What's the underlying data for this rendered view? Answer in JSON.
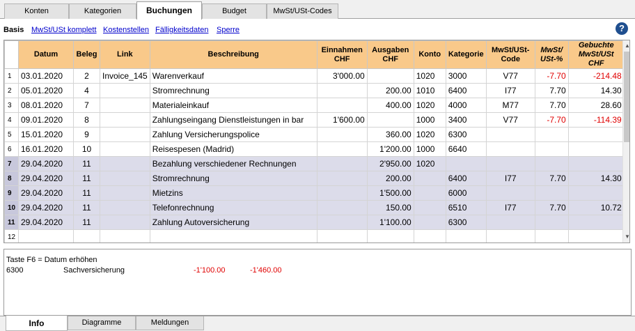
{
  "tabs": [
    "Konten",
    "Kategorien",
    "Buchungen",
    "Budget",
    "MwSt/USt-Codes"
  ],
  "active_tab": "Buchungen",
  "subbar": {
    "view": "Basis",
    "links": [
      "MwSt/USt komplett",
      "Kostenstellen",
      "Fälligkeitsdaten",
      "Sperre"
    ],
    "help": "?"
  },
  "columns": [
    {
      "l1": "Datum",
      "l2": ""
    },
    {
      "l1": "Beleg",
      "l2": ""
    },
    {
      "l1": "Link",
      "l2": ""
    },
    {
      "l1": "Beschreibung",
      "l2": ""
    },
    {
      "l1": "Einnahmen",
      "l2": "CHF"
    },
    {
      "l1": "Ausgaben",
      "l2": "CHF"
    },
    {
      "l1": "Konto",
      "l2": ""
    },
    {
      "l1": "Kategorie",
      "l2": ""
    },
    {
      "l1": "MwSt/USt-",
      "l2": "Code"
    },
    {
      "l1": "MwSt/",
      "l2": "USt-%"
    },
    {
      "l1": "Gebuchte",
      "l2": "MwSt/USt CHF"
    }
  ],
  "rows": [
    {
      "n": "1",
      "datum": "03.01.2020",
      "beleg": "2",
      "link": "Invoice_145",
      "beschreibung": "Warenverkauf",
      "einnahmen": "3'000.00",
      "ausgaben": "",
      "konto": "1020",
      "kategorie": "3000",
      "code": "V77",
      "pct": "-7.70",
      "gebucht": "-214.48"
    },
    {
      "n": "2",
      "datum": "05.01.2020",
      "beleg": "4",
      "link": "",
      "beschreibung": "Stromrechnung",
      "einnahmen": "",
      "ausgaben": "200.00",
      "konto": "1010",
      "kategorie": "6400",
      "code": "I77",
      "pct": "7.70",
      "gebucht": "14.30"
    },
    {
      "n": "3",
      "datum": "08.01.2020",
      "beleg": "7",
      "link": "",
      "beschreibung": "Materialeinkauf",
      "einnahmen": "",
      "ausgaben": "400.00",
      "konto": "1020",
      "kategorie": "4000",
      "code": "M77",
      "pct": "7.70",
      "gebucht": "28.60"
    },
    {
      "n": "4",
      "datum": "09.01.2020",
      "beleg": "8",
      "link": "",
      "beschreibung": "Zahlungseingang Dienstleistungen in bar",
      "einnahmen": "1'600.00",
      "ausgaben": "",
      "konto": "1000",
      "kategorie": "3400",
      "code": "V77",
      "pct": "-7.70",
      "gebucht": "-114.39"
    },
    {
      "n": "5",
      "datum": "15.01.2020",
      "beleg": "9",
      "link": "",
      "beschreibung": "Zahlung Versicherungspolice",
      "einnahmen": "",
      "ausgaben": "360.00",
      "konto": "1020",
      "kategorie": "6300",
      "code": "",
      "pct": "",
      "gebucht": ""
    },
    {
      "n": "6",
      "datum": "16.01.2020",
      "beleg": "10",
      "link": "",
      "beschreibung": "Reisespesen (Madrid)",
      "einnahmen": "",
      "ausgaben": "1'200.00",
      "konto": "1000",
      "kategorie": "6640",
      "code": "",
      "pct": "",
      "gebucht": ""
    },
    {
      "n": "7",
      "datum": "29.04.2020",
      "beleg": "11",
      "link": "",
      "beschreibung": "Bezahlung verschiedener Rechnungen",
      "einnahmen": "",
      "ausgaben": "2'950.00",
      "konto": "1020",
      "kategorie": "",
      "code": "",
      "pct": "",
      "gebucht": ""
    },
    {
      "n": "8",
      "datum": "29.04.2020",
      "beleg": "11",
      "link": "",
      "beschreibung": "Stromrechnung",
      "einnahmen": "",
      "ausgaben": "200.00",
      "konto": "",
      "kategorie": "6400",
      "code": "I77",
      "pct": "7.70",
      "gebucht": "14.30"
    },
    {
      "n": "9",
      "datum": "29.04.2020",
      "beleg": "11",
      "link": "",
      "beschreibung": "Mietzins",
      "einnahmen": "",
      "ausgaben": "1'500.00",
      "konto": "",
      "kategorie": "6000",
      "code": "",
      "pct": "",
      "gebucht": ""
    },
    {
      "n": "10",
      "datum": "29.04.2020",
      "beleg": "11",
      "link": "",
      "beschreibung": "Telefonrechnung",
      "einnahmen": "",
      "ausgaben": "150.00",
      "konto": "",
      "kategorie": "6510",
      "code": "I77",
      "pct": "7.70",
      "gebucht": "10.72"
    },
    {
      "n": "11",
      "datum": "29.04.2020",
      "beleg": "11",
      "link": "",
      "beschreibung": "Zahlung Autoversicherung",
      "einnahmen": "",
      "ausgaben": "1'100.00",
      "konto": "",
      "kategorie": "6300",
      "code": "",
      "pct": "",
      "gebucht": ""
    },
    {
      "n": "12",
      "datum": "",
      "beleg": "",
      "link": "",
      "beschreibung": "",
      "einnahmen": "",
      "ausgaben": "",
      "konto": "",
      "kategorie": "",
      "code": "",
      "pct": "",
      "gebucht": ""
    }
  ],
  "info": {
    "hint": "Taste F6 = Datum erhöhen",
    "account": "6300",
    "account_name": "Sachversicherung",
    "amount1": "-1'100.00",
    "amount2": "-1'460.00"
  },
  "bottom_tabs": [
    "Info",
    "Diagramme",
    "Meldungen"
  ],
  "colors": {
    "header": "#f9c98a",
    "highlight": "#dcdcea",
    "negative": "#e00000",
    "link": "#0000cc"
  }
}
